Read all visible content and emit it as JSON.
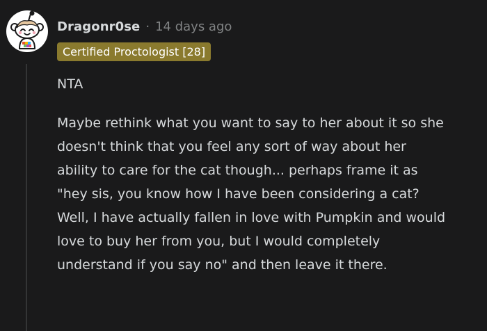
{
  "comment": {
    "username": "Dragonr0se",
    "separator": "·",
    "timestamp": "14 days ago",
    "flair": "Certified Proctologist [28]",
    "verdict": "NTA",
    "text": "Maybe rethink what you want to say to her about it so she doesn't think that you feel any sort of way about her ability to care for the cat though... perhaps frame it as \"hey sis, you know how I have been considering a cat? Well, I have actually fallen in love with Pumpkin and would love to buy her from you, but I would completely understand if you say no\" and then leave it there."
  },
  "colors": {
    "background": "#1a1a1b",
    "text": "#d7dadc",
    "muted": "#818384",
    "flair_bg": "#8a7a2e",
    "thread_line": "#343536"
  },
  "icons": {
    "avatar": "snoo-avatar-icon"
  }
}
